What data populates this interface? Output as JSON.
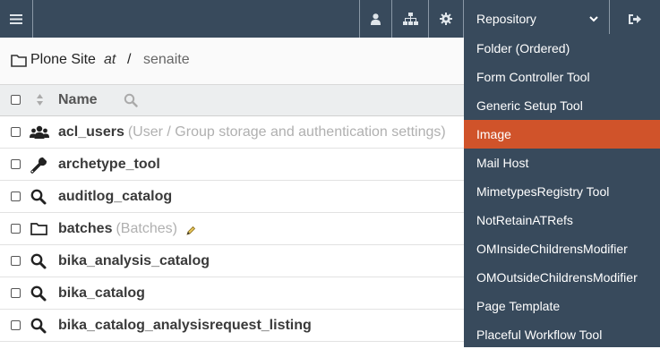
{
  "topbar": {
    "repository_label": "Repository",
    "icons": [
      "menu-icon",
      "user-icon",
      "sitemap-icon",
      "gear-icon",
      "chevron-down-icon",
      "logout-icon"
    ]
  },
  "breadcrumb": {
    "site": "Plone Site",
    "at": "at",
    "separator": "/",
    "current": "senaite"
  },
  "table": {
    "header_name": "Name",
    "rows": [
      {
        "icon": "users-icon",
        "name": "acl_users",
        "desc": "(User / Group storage and authentication settings)"
      },
      {
        "icon": "wrench-icon",
        "name": "archetype_tool",
        "desc": ""
      },
      {
        "icon": "search-icon",
        "name": "auditlog_catalog",
        "desc": ""
      },
      {
        "icon": "folder-icon",
        "name": "batches",
        "desc": "(Batches)"
      },
      {
        "icon": "search-icon",
        "name": "bika_analysis_catalog",
        "desc": ""
      },
      {
        "icon": "search-icon",
        "name": "bika_catalog",
        "desc": ""
      },
      {
        "icon": "search-icon",
        "name": "bika_catalog_analysisrequest_listing",
        "desc": ""
      }
    ]
  },
  "dropdown": {
    "items": [
      "Folder (Ordered)",
      "Form Controller Tool",
      "Generic Setup Tool",
      "Image",
      "Mail Host",
      "MimetypesRegistry Tool",
      "NotRetainATRefs",
      "OMInsideChildrensModifier",
      "OMOutsideChildrensModifier",
      "Page Template",
      "Placeful Workflow Tool"
    ],
    "active_index": 3,
    "active_color": "#d0532a",
    "bg_color": "#384a5c"
  }
}
